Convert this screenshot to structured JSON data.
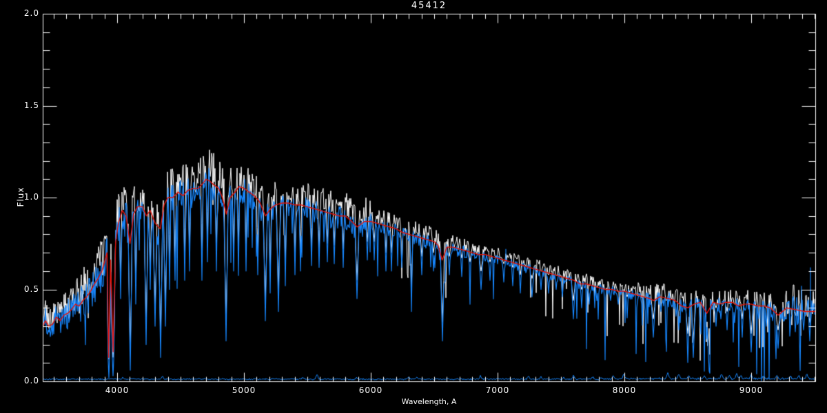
{
  "chart_data": {
    "type": "line",
    "title": "45412",
    "xlabel": "Wavelength, A",
    "ylabel": "Flux",
    "xlim": [
      3413,
      9505
    ],
    "ylim": [
      0.0,
      2.0
    ],
    "grid": false,
    "legend": "none",
    "x_major_ticks": {
      "values": [
        4000,
        5000,
        6000,
        7000,
        8000,
        9000
      ],
      "labels": [
        "4000",
        "5000",
        "6000",
        "7000",
        "8000",
        "9000"
      ]
    },
    "x_minor_step": 100,
    "y_major_ticks": {
      "values": [
        0.0,
        0.5,
        1.0,
        1.5,
        2.0
      ],
      "labels": [
        "0.0",
        "0.5",
        "1.0",
        "1.5",
        "2.0"
      ]
    },
    "y_minor_step": 0.1,
    "colors": {
      "background": "#000000",
      "axis": "#FFFFFF",
      "observed": "#FFFFFF",
      "template": "#1685FB",
      "smoothed": "#E51208",
      "baseline": "#1685FB"
    },
    "series": [
      {
        "name": "observed-spectrum",
        "color": "#FFFFFF",
        "style": "noisy"
      },
      {
        "name": "template-spectrum",
        "color": "#1685FB",
        "style": "noisy-with-absorption"
      },
      {
        "name": "smoothed-fit",
        "color": "#E51208",
        "style": "smooth",
        "points": [
          [
            3413,
            0.3
          ],
          [
            3435,
            0.33
          ],
          [
            3460,
            0.3
          ],
          [
            3490,
            0.31
          ],
          [
            3520,
            0.35
          ],
          [
            3550,
            0.33
          ],
          [
            3580,
            0.36
          ],
          [
            3610,
            0.37
          ],
          [
            3640,
            0.39
          ],
          [
            3670,
            0.42
          ],
          [
            3700,
            0.41
          ],
          [
            3730,
            0.44
          ],
          [
            3760,
            0.46
          ],
          [
            3790,
            0.49
          ],
          [
            3820,
            0.53
          ],
          [
            3850,
            0.56
          ],
          [
            3880,
            0.6
          ],
          [
            3905,
            0.66
          ],
          [
            3920,
            0.7
          ],
          [
            3933,
            0.13
          ],
          [
            3948,
            0.66
          ],
          [
            3968,
            0.16
          ],
          [
            3988,
            0.76
          ],
          [
            4010,
            0.86
          ],
          [
            4040,
            0.93
          ],
          [
            4070,
            0.9
          ],
          [
            4101,
            0.75
          ],
          [
            4130,
            0.91
          ],
          [
            4160,
            0.95
          ],
          [
            4200,
            0.95
          ],
          [
            4230,
            0.9
          ],
          [
            4260,
            0.93
          ],
          [
            4300,
            0.86
          ],
          [
            4340,
            0.83
          ],
          [
            4370,
            0.96
          ],
          [
            4400,
            1.0
          ],
          [
            4440,
            1.0
          ],
          [
            4480,
            1.03
          ],
          [
            4520,
            1.01
          ],
          [
            4560,
            1.04
          ],
          [
            4600,
            1.05
          ],
          [
            4640,
            1.05
          ],
          [
            4680,
            1.08
          ],
          [
            4700,
            1.1
          ],
          [
            4730,
            1.09
          ],
          [
            4760,
            1.07
          ],
          [
            4800,
            1.05
          ],
          [
            4830,
            1.0
          ],
          [
            4861,
            0.91
          ],
          [
            4890,
            1.0
          ],
          [
            4930,
            1.03
          ],
          [
            4960,
            1.06
          ],
          [
            5000,
            1.05
          ],
          [
            5040,
            1.03
          ],
          [
            5080,
            1.01
          ],
          [
            5120,
            0.98
          ],
          [
            5170,
            0.9
          ],
          [
            5210,
            0.94
          ],
          [
            5250,
            0.96
          ],
          [
            5300,
            0.97
          ],
          [
            5350,
            0.97
          ],
          [
            5400,
            0.96
          ],
          [
            5450,
            0.96
          ],
          [
            5500,
            0.95
          ],
          [
            5550,
            0.94
          ],
          [
            5600,
            0.93
          ],
          [
            5650,
            0.92
          ],
          [
            5700,
            0.91
          ],
          [
            5750,
            0.9
          ],
          [
            5800,
            0.9
          ],
          [
            5850,
            0.87
          ],
          [
            5893,
            0.84
          ],
          [
            5950,
            0.87
          ],
          [
            6000,
            0.87
          ],
          [
            6050,
            0.86
          ],
          [
            6100,
            0.85
          ],
          [
            6150,
            0.84
          ],
          [
            6200,
            0.83
          ],
          [
            6250,
            0.81
          ],
          [
            6300,
            0.8
          ],
          [
            6350,
            0.79
          ],
          [
            6400,
            0.78
          ],
          [
            6450,
            0.77
          ],
          [
            6500,
            0.76
          ],
          [
            6530,
            0.74
          ],
          [
            6563,
            0.66
          ],
          [
            6600,
            0.73
          ],
          [
            6650,
            0.73
          ],
          [
            6700,
            0.72
          ],
          [
            6750,
            0.71
          ],
          [
            6800,
            0.7
          ],
          [
            6850,
            0.69
          ],
          [
            6900,
            0.69
          ],
          [
            6950,
            0.68
          ],
          [
            7000,
            0.67
          ],
          [
            7050,
            0.66
          ],
          [
            7100,
            0.65
          ],
          [
            7150,
            0.64
          ],
          [
            7200,
            0.63
          ],
          [
            7250,
            0.62
          ],
          [
            7300,
            0.61
          ],
          [
            7350,
            0.6
          ],
          [
            7400,
            0.59
          ],
          [
            7450,
            0.58
          ],
          [
            7500,
            0.57
          ],
          [
            7550,
            0.56
          ],
          [
            7600,
            0.55
          ],
          [
            7650,
            0.53
          ],
          [
            7700,
            0.53
          ],
          [
            7750,
            0.52
          ],
          [
            7800,
            0.51
          ],
          [
            7850,
            0.5
          ],
          [
            7900,
            0.5
          ],
          [
            7950,
            0.49
          ],
          [
            8000,
            0.49
          ],
          [
            8050,
            0.48
          ],
          [
            8100,
            0.47
          ],
          [
            8150,
            0.46
          ],
          [
            8200,
            0.45
          ],
          [
            8230,
            0.44
          ],
          [
            8280,
            0.46
          ],
          [
            8350,
            0.45
          ],
          [
            8400,
            0.44
          ],
          [
            8450,
            0.41
          ],
          [
            8500,
            0.4
          ],
          [
            8550,
            0.42
          ],
          [
            8600,
            0.43
          ],
          [
            8650,
            0.37
          ],
          [
            8700,
            0.43
          ],
          [
            8750,
            0.42
          ],
          [
            8800,
            0.43
          ],
          [
            8850,
            0.43
          ],
          [
            8900,
            0.41
          ],
          [
            8950,
            0.42
          ],
          [
            9000,
            0.42
          ],
          [
            9050,
            0.41
          ],
          [
            9100,
            0.41
          ],
          [
            9150,
            0.4
          ],
          [
            9212,
            0.36
          ],
          [
            9280,
            0.4
          ],
          [
            9350,
            0.39
          ],
          [
            9420,
            0.38
          ],
          [
            9505,
            0.38
          ]
        ]
      },
      {
        "name": "sky-baseline",
        "color": "#1685FB",
        "style": "baseline",
        "level": 0.012,
        "bumps": [
          [
            4046,
            0.02
          ],
          [
            4358,
            0.025
          ],
          [
            5461,
            0.02
          ],
          [
            5577,
            0.035
          ],
          [
            5890,
            0.02
          ],
          [
            6300,
            0.025
          ],
          [
            6364,
            0.02
          ],
          [
            6863,
            0.03
          ],
          [
            7245,
            0.03
          ],
          [
            7340,
            0.025
          ],
          [
            7521,
            0.02
          ],
          [
            7600,
            0.03
          ],
          [
            7750,
            0.025
          ],
          [
            7820,
            0.02
          ],
          [
            7913,
            0.03
          ],
          [
            7993,
            0.035
          ],
          [
            8344,
            0.04
          ],
          [
            8430,
            0.035
          ],
          [
            8505,
            0.03
          ],
          [
            8630,
            0.03
          ],
          [
            8767,
            0.035
          ],
          [
            8827,
            0.03
          ],
          [
            8885,
            0.04
          ],
          [
            8920,
            0.03
          ],
          [
            9001,
            0.03
          ],
          [
            9100,
            0.025
          ],
          [
            9200,
            0.03
          ],
          [
            9310,
            0.025
          ],
          [
            9375,
            0.03
          ],
          [
            9440,
            0.035
          ]
        ]
      }
    ],
    "absorption_lines": [
      [
        3933,
        0.02,
        2
      ],
      [
        3968,
        0.03,
        2
      ],
      [
        4026,
        0.45,
        1
      ],
      [
        4101,
        0.06,
        2
      ],
      [
        4144,
        0.42,
        1
      ],
      [
        4226,
        0.2,
        2
      ],
      [
        4260,
        0.5,
        1
      ],
      [
        4300,
        0.3,
        2
      ],
      [
        4340,
        0.13,
        2
      ],
      [
        4383,
        0.3,
        2
      ],
      [
        4415,
        0.5,
        1
      ],
      [
        4455,
        0.55,
        1
      ],
      [
        4531,
        0.55,
        1
      ],
      [
        4571,
        0.6,
        1
      ],
      [
        4668,
        0.55,
        1
      ],
      [
        4710,
        0.65,
        1
      ],
      [
        4785,
        0.6,
        1
      ],
      [
        4861,
        0.22,
        2
      ],
      [
        4920,
        0.6,
        1
      ],
      [
        4957,
        0.62,
        1
      ],
      [
        5015,
        0.6,
        1
      ],
      [
        5110,
        0.58,
        1
      ],
      [
        5170,
        0.33,
        2
      ],
      [
        5208,
        0.48,
        1
      ],
      [
        5270,
        0.38,
        2
      ],
      [
        5328,
        0.52,
        1
      ],
      [
        5400,
        0.58,
        1
      ],
      [
        5446,
        0.6,
        1
      ],
      [
        5530,
        0.63,
        1
      ],
      [
        5590,
        0.62,
        1
      ],
      [
        5660,
        0.65,
        1
      ],
      [
        5710,
        0.64,
        1
      ],
      [
        5785,
        0.62,
        1
      ],
      [
        5893,
        0.45,
        2
      ],
      [
        5970,
        0.66,
        1
      ],
      [
        6025,
        0.66,
        1
      ],
      [
        6122,
        0.6,
        1
      ],
      [
        6162,
        0.6,
        1
      ],
      [
        6246,
        0.62,
        1
      ],
      [
        6318,
        0.38,
        1
      ],
      [
        6400,
        0.58,
        1
      ],
      [
        6495,
        0.6,
        1
      ],
      [
        6563,
        0.22,
        2
      ],
      [
        6620,
        0.58,
        1
      ],
      [
        6717,
        0.57,
        1
      ],
      [
        6780,
        0.55,
        1
      ],
      [
        6870,
        0.5,
        2
      ],
      [
        6940,
        0.55,
        1
      ],
      [
        7050,
        0.54,
        1
      ],
      [
        7120,
        0.52,
        1
      ],
      [
        7180,
        0.48,
        1
      ],
      [
        7270,
        0.46,
        2
      ],
      [
        7340,
        0.5,
        1
      ],
      [
        7400,
        0.48,
        1
      ],
      [
        7460,
        0.5,
        1
      ],
      [
        7510,
        0.46,
        1
      ],
      [
        7600,
        0.34,
        2
      ],
      [
        7665,
        0.4,
        1
      ],
      [
        7720,
        0.42,
        1
      ],
      [
        7780,
        0.44,
        1
      ],
      [
        7850,
        0.4,
        1
      ],
      [
        7890,
        0.44,
        1
      ],
      [
        7950,
        0.42,
        1
      ],
      [
        8020,
        0.36,
        1
      ],
      [
        8100,
        0.4,
        1
      ],
      [
        8160,
        0.38,
        1
      ],
      [
        8230,
        0.24,
        2
      ],
      [
        8290,
        0.38,
        1
      ],
      [
        8330,
        0.34,
        1
      ],
      [
        8430,
        0.28,
        1
      ],
      [
        8498,
        0.16,
        2
      ],
      [
        8542,
        0.13,
        2
      ],
      [
        8600,
        0.32,
        1
      ],
      [
        8662,
        0.14,
        2
      ],
      [
        8720,
        0.3,
        1
      ],
      [
        8760,
        0.34,
        1
      ],
      [
        8810,
        0.28,
        1
      ],
      [
        8870,
        0.32,
        1
      ],
      [
        8930,
        0.24,
        1
      ],
      [
        9000,
        0.16,
        2
      ],
      [
        9060,
        0.34,
        1
      ],
      [
        9120,
        0.3,
        1
      ],
      [
        9170,
        0.33,
        1
      ],
      [
        9212,
        0.18,
        2
      ],
      [
        9260,
        0.33,
        1
      ],
      [
        9310,
        0.3,
        1
      ],
      [
        9350,
        0.27,
        1
      ],
      [
        9410,
        0.28,
        1
      ],
      [
        9460,
        0.22,
        1
      ]
    ],
    "emission_spikes": [
      [
        7065,
        0.72
      ],
      [
        9396,
        0.52
      ],
      [
        9467,
        0.62
      ]
    ],
    "noise": {
      "seed": 1337,
      "amplitude_regions": [
        [
          3413,
          3700,
          0.11
        ],
        [
          3700,
          4000,
          0.13
        ],
        [
          4000,
          4900,
          0.12
        ],
        [
          4900,
          6000,
          0.09
        ],
        [
          6000,
          6800,
          0.05
        ],
        [
          6800,
          8100,
          0.035
        ],
        [
          8100,
          9250,
          0.055
        ],
        [
          9250,
          9505,
          0.1
        ]
      ],
      "white_dip_prob": 0.03,
      "blue_dip_prob": 0.05,
      "telluric_boost_from": 8100
    }
  }
}
